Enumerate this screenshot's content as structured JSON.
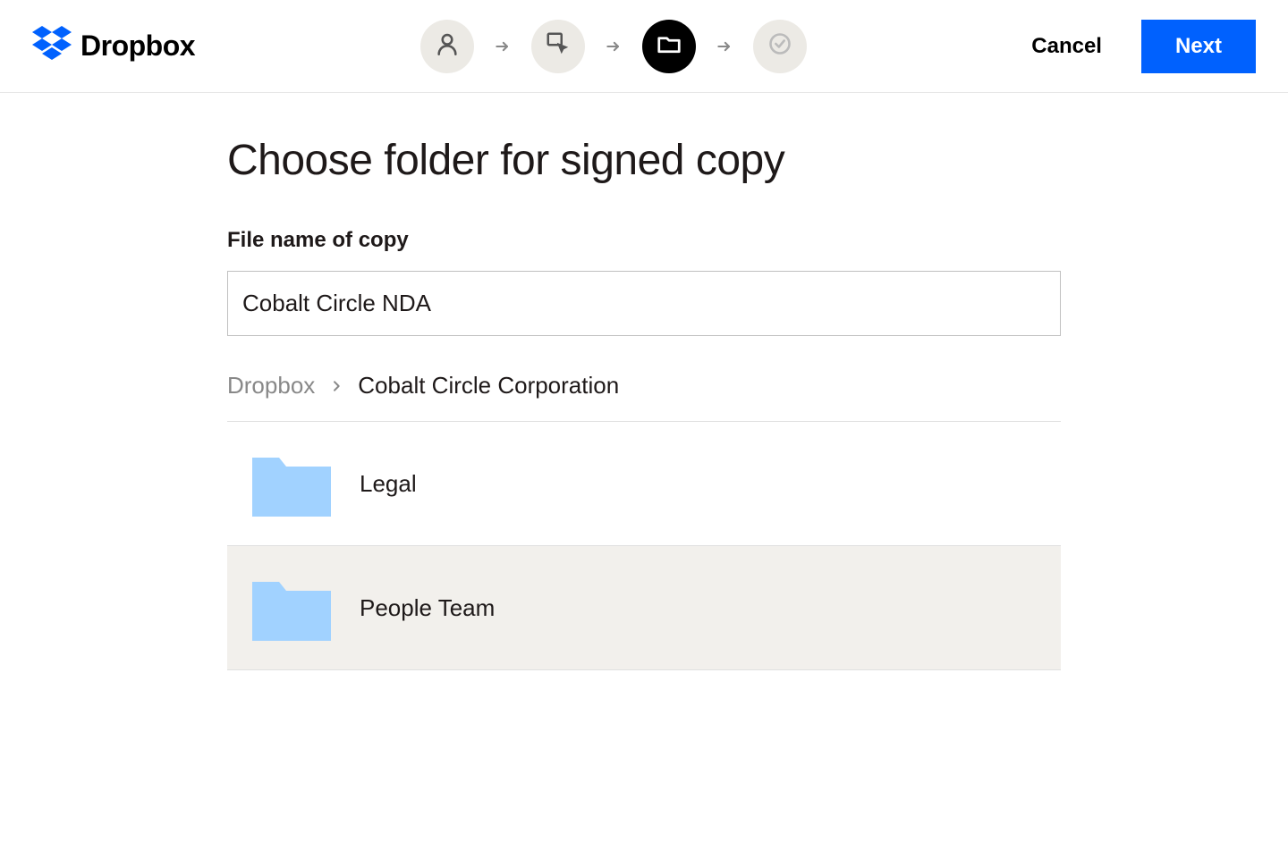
{
  "brand": {
    "name": "Dropbox"
  },
  "header": {
    "cancel_label": "Cancel",
    "next_label": "Next"
  },
  "stepper": {
    "steps": [
      {
        "icon": "person",
        "active": false
      },
      {
        "icon": "click",
        "active": false
      },
      {
        "icon": "folder",
        "active": true
      },
      {
        "icon": "check",
        "active": false
      }
    ]
  },
  "main": {
    "title": "Choose folder for signed copy",
    "filename_label": "File name of copy",
    "filename_value": "Cobalt Circle NDA"
  },
  "breadcrumb": {
    "root": "Dropbox",
    "current": "Cobalt Circle Corporation"
  },
  "folders": [
    {
      "name": "Legal",
      "selected": false
    },
    {
      "name": "People Team",
      "selected": true
    }
  ],
  "colors": {
    "primary_blue": "#0061fe",
    "folder_blue": "#a2d2ff"
  }
}
